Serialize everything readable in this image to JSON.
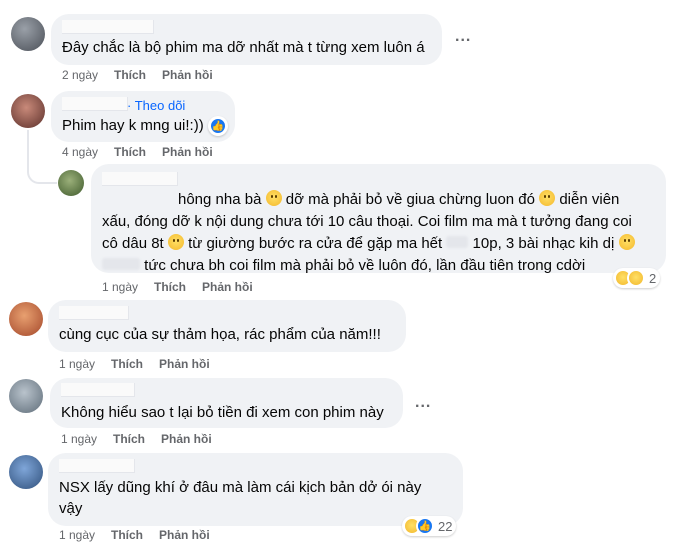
{
  "comments": [
    {
      "text": "Đây chắc là bộ phim ma dỡ nhất mà t từng xem luôn á",
      "time": "2 ngày",
      "like": "Thích",
      "reply": "Phản hồi",
      "menu": "..."
    },
    {
      "follow": "Theo dõi",
      "text": "Phim hay k mng ui!:))",
      "time": "4 ngày",
      "like": "Thích",
      "reply": "Phản hồi"
    },
    {
      "line1_after": "hông nha bà",
      "line1_b": "dỡ mà phải bỏ về giua chừng luon đó",
      "line1_c": "diễn viên",
      "line2": "xấu, đóng dỡ k nội dung chưa tới 10 câu thoại. Coi film ma mà t tưởng đang coi",
      "line3_a": "cô dâu 8t",
      "line3_b": "từ giường bước ra cửa để gặp ma hết",
      "line3_c": "10p, 3 bài nhạc kih dị",
      "line4": "tức chưa bh coi film mà phải bỏ về luôn đó, lần đầu tiên trong cdời",
      "time": "1 ngày",
      "like": "Thích",
      "reply": "Phản hồi",
      "reaction_count": "2"
    },
    {
      "text": "cùng cục của sự thảm họa, rác phẩm của năm!!!",
      "time": "1 ngày",
      "like": "Thích",
      "reply": "Phản hồi"
    },
    {
      "text": "Không hiểu sao t lại bỏ tiền đi xem con phim này",
      "time": "1 ngày",
      "like": "Thích",
      "reply": "Phản hồi",
      "menu": "..."
    },
    {
      "text_line1": "NSX lấy dũng khí ở đâu mà làm cái kịch bản dở ói này",
      "text_line2": "vậy",
      "time": "1 ngày",
      "like": "Thích",
      "reply": "Phản hồi",
      "reaction_count": "22"
    }
  ],
  "colors": {
    "bubble": "#f0f2f5",
    "link": "#0866ff",
    "meta": "#65676b",
    "like_blue": "#1877f2"
  }
}
